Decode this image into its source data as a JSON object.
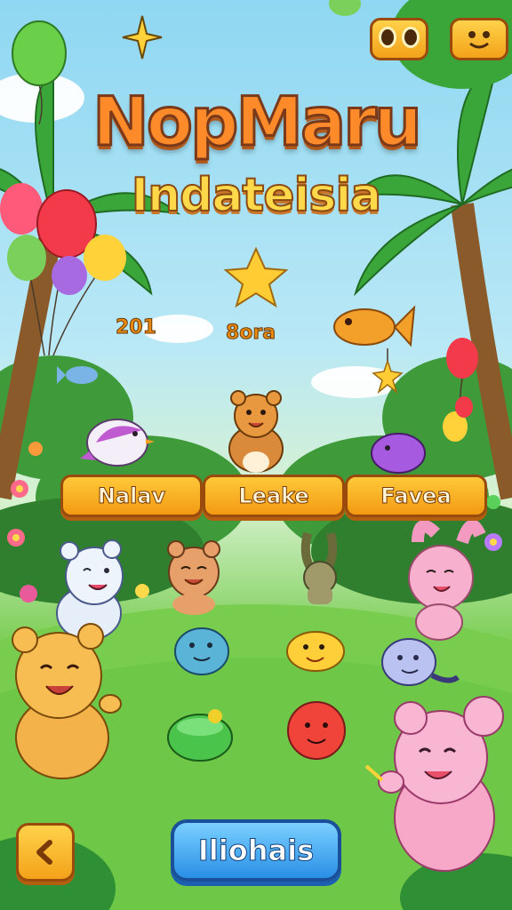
{
  "title": {
    "line1": "NopMaru",
    "line2": "Indateisia"
  },
  "scores": {
    "left": "201",
    "middle": "8ora"
  },
  "levels": [
    {
      "label": "Nalav"
    },
    {
      "label": "Leake"
    },
    {
      "label": "Favea"
    }
  ],
  "main_button": {
    "label": "Iliohais"
  },
  "icons": {
    "top_left": "goggles-eyes-icon",
    "top_right": "smiley-face-icon",
    "back": "chevron-left-icon"
  },
  "colors": {
    "title": "#ff8a2a",
    "level_button": "#f5a81c",
    "main_button": "#2a8fe6",
    "grass": "#66c244"
  }
}
